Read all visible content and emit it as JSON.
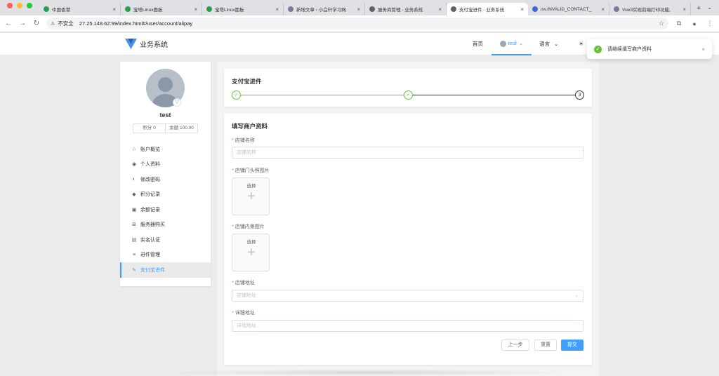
{
  "browser": {
    "tabs": [
      {
        "title": "中国香港",
        "favicon_color": "#2e9b4f"
      },
      {
        "title": "宝塔Linux面板",
        "favicon_color": "#2e9b4f"
      },
      {
        "title": "宝塔Linux面板",
        "favicon_color": "#2e9b4f"
      },
      {
        "title": "新增文章 ‹ 小白轩学习网",
        "favicon_color": "#7a7aa0"
      },
      {
        "title": "服务商管理 - 业务系统",
        "favicon_color": "#5f6368"
      },
      {
        "title": "支付宝进件 - 业务系统",
        "favicon_color": "#5f6368"
      },
      {
        "title": "isv.INVALID_CONTACT_",
        "favicon_color": "#3a6bd4"
      },
      {
        "title": "Vue3实现前端打印功能,",
        "favicon_color": "#7a7aa0"
      }
    ],
    "close_glyph": "×",
    "new_tab": "+",
    "tab_menu": "⌄",
    "insecure_label": "不安全",
    "url": "27.25.148.62:99/index.html#/user/account/alipay"
  },
  "header": {
    "brand": "业务系统",
    "nav_home": "首页",
    "nav_user": "test",
    "nav_lang": "语言",
    "chevron": "⌄"
  },
  "profile": {
    "username": "test",
    "points": "积分 0",
    "balance": "余额 100.00"
  },
  "sidebar": {
    "items": [
      {
        "label": "账户概览",
        "icon": "home-icon"
      },
      {
        "label": "个人资料",
        "icon": "user-circle-icon"
      },
      {
        "label": "修改密码",
        "icon": "shield-icon"
      },
      {
        "label": "积分记录",
        "icon": "tag-icon"
      },
      {
        "label": "余额记录",
        "icon": "money-icon"
      },
      {
        "label": "服务器购买",
        "icon": "cart-icon"
      },
      {
        "label": "实名认证",
        "icon": "id-card-icon"
      },
      {
        "label": "进件管理",
        "icon": "list-icon"
      },
      {
        "label": "支付宝进件",
        "icon": "edit-icon"
      }
    ],
    "active_index": 8
  },
  "steps": {
    "title": "支付宝进件",
    "step3_number": "3",
    "check": "✓"
  },
  "form": {
    "title": "填写商户资料",
    "required_mark": "*",
    "store_name_label": "店铺名称",
    "store_name_placeholder": "店铺名称",
    "storefront_image_label": "店铺门头照图片",
    "interior_image_label": "店铺内景图片",
    "upload_label": "选择",
    "upload_plus": "+",
    "address_label": "店铺地址",
    "address_placeholder": "店铺地址",
    "detail_address_label": "详细地址",
    "detail_address_placeholder": "详细地址",
    "btn_prev": "上一步",
    "btn_reset": "重置",
    "btn_submit": "提交"
  },
  "toast": {
    "message": "请继续填写商户资料",
    "close": "×"
  },
  "colors": {
    "primary": "#409eff",
    "success": "#67c23a",
    "danger": "#f56c6c"
  }
}
